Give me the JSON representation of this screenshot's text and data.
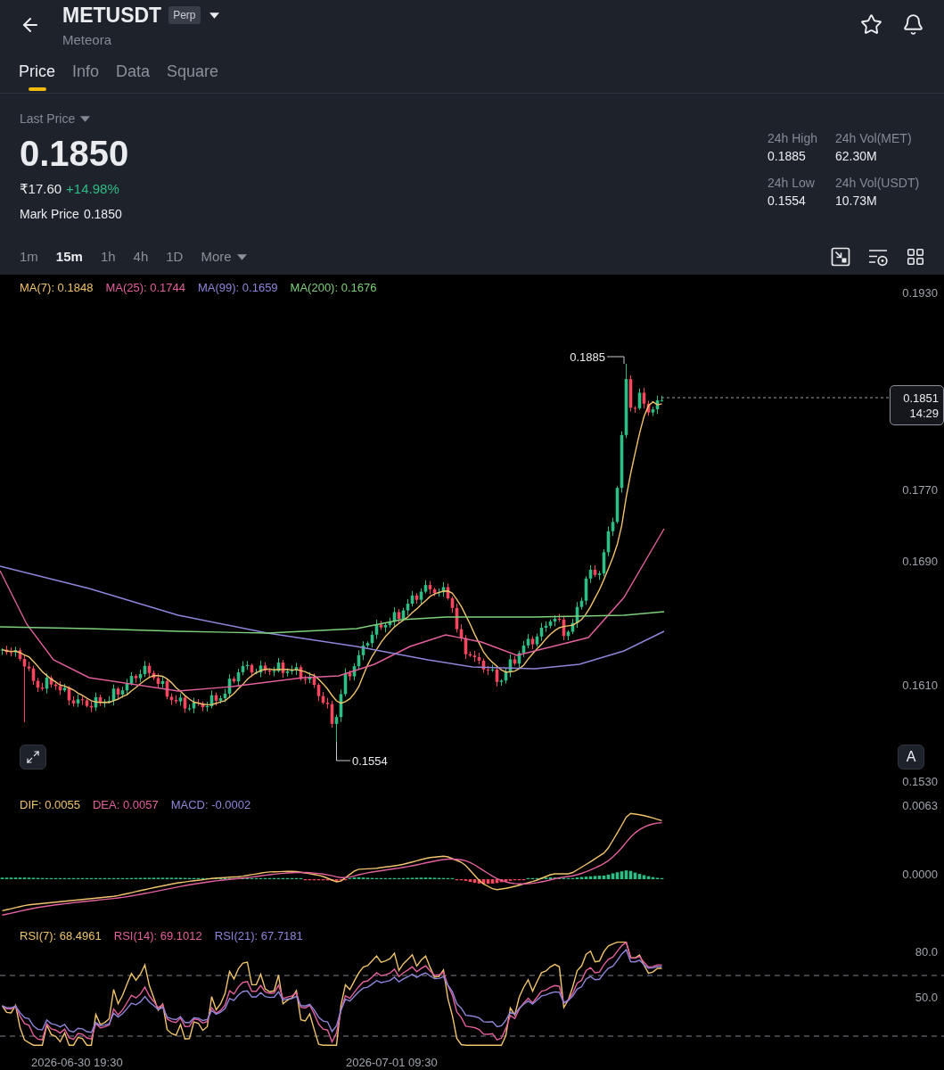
{
  "header": {
    "symbol": "METUSDT",
    "badge": "Perp",
    "name": "Meteora"
  },
  "tabs": [
    {
      "label": "Price",
      "selected": true
    },
    {
      "label": "Info",
      "selected": false
    },
    {
      "label": "Data",
      "selected": false
    },
    {
      "label": "Square",
      "selected": false
    }
  ],
  "price": {
    "label": "Last Price",
    "value": "0.1850",
    "fiat": "₹17.60",
    "change": "+14.98%",
    "mark_label": "Mark Price",
    "mark_value": "0.1850"
  },
  "stats": [
    {
      "label": "24h High",
      "value": "0.1885"
    },
    {
      "label": "24h Vol(MET)",
      "value": "62.30M"
    },
    {
      "label": "24h Low",
      "value": "0.1554"
    },
    {
      "label": "24h Vol(USDT)",
      "value": "10.73M"
    }
  ],
  "intervals": [
    {
      "label": "1m",
      "kind": "interval",
      "selected": false
    },
    {
      "label": "15m",
      "kind": "interval",
      "selected": true
    },
    {
      "label": "1h",
      "kind": "interval",
      "selected": false
    },
    {
      "label": "4h",
      "kind": "interval",
      "selected": false
    },
    {
      "label": "1D",
      "kind": "interval",
      "selected": false
    },
    {
      "label": "More",
      "kind": "menu",
      "selected": false
    }
  ],
  "chart": {
    "legend": [
      {
        "label": "MA(7): 0.1848",
        "color": "#f0c36d"
      },
      {
        "label": "MA(25): 0.1744",
        "color": "#e2609c"
      },
      {
        "label": "MA(99): 0.1659",
        "color": "#8e86d9"
      },
      {
        "label": "MA(200): 0.1676",
        "color": "#7fd07c"
      }
    ],
    "price_axis": [
      "0.1930",
      "0.1770",
      "0.1690",
      "0.1610",
      "0.1530"
    ],
    "high_label": "0.1885",
    "low_label": "0.1554",
    "price_tag": {
      "price": "0.1851",
      "countdown": "14:29"
    },
    "scale_button": "A"
  },
  "macd": {
    "legend": [
      {
        "label": "DIF: 0.0055",
        "color": "#f0c36d"
      },
      {
        "label": "DEA: 0.0057",
        "color": "#e2609c"
      },
      {
        "label": "MACD: -0.0002",
        "color": "#8e86d9"
      }
    ],
    "axis": [
      "0.0063",
      "0.0000"
    ]
  },
  "rsi": {
    "legend": [
      {
        "label": "RSI(7): 68.4961",
        "color": "#f0c36d"
      },
      {
        "label": "RSI(14): 69.1012",
        "color": "#e2609c"
      },
      {
        "label": "RSI(21): 67.7181",
        "color": "#8e86d9"
      }
    ],
    "axis": [
      "80.0",
      "50.0"
    ],
    "time_axis": [
      "2026-06-30 19:30",
      "2026-07-01 09:30"
    ]
  }
}
